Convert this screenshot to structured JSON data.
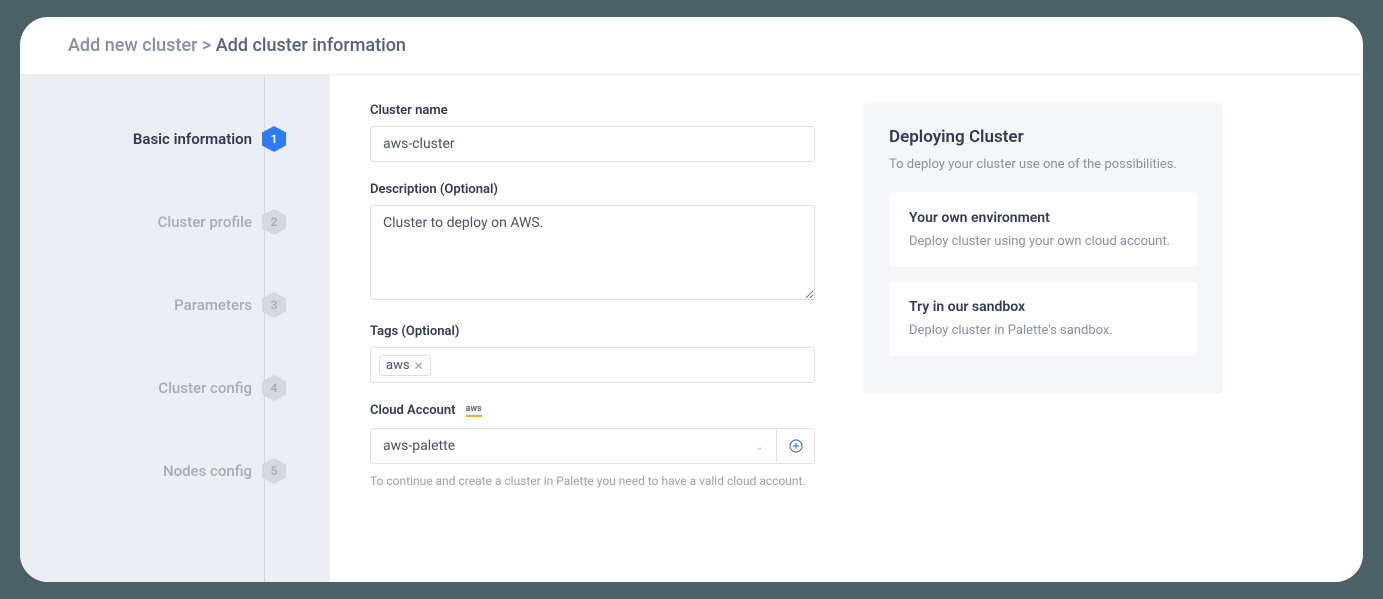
{
  "breadcrumb": {
    "parent": "Add new cluster",
    "separator": ">",
    "current": "Add cluster information"
  },
  "steps": [
    {
      "num": "1",
      "label": "Basic information",
      "active": true
    },
    {
      "num": "2",
      "label": "Cluster profile",
      "active": false
    },
    {
      "num": "3",
      "label": "Parameters",
      "active": false
    },
    {
      "num": "4",
      "label": "Cluster config",
      "active": false
    },
    {
      "num": "5",
      "label": "Nodes config",
      "active": false
    }
  ],
  "form": {
    "cluster_name": {
      "label": "Cluster name",
      "value": "aws-cluster"
    },
    "description": {
      "label": "Description (Optional)",
      "value": "Cluster to deploy on AWS."
    },
    "tags": {
      "label": "Tags (Optional)",
      "items": [
        "aws"
      ]
    },
    "cloud_account": {
      "label": "Cloud Account",
      "provider_badge": "aws",
      "selected": "aws-palette",
      "helper": "To continue and create a cluster in Palette you need to have a valid cloud account."
    }
  },
  "info": {
    "title": "Deploying Cluster",
    "subtitle": "To deploy your cluster use one of the possibilities.",
    "cards": [
      {
        "title": "Your own environment",
        "desc": "Deploy cluster using your own cloud account."
      },
      {
        "title": "Try in our sandbox",
        "desc": "Deploy cluster in Palette's sandbox."
      }
    ]
  }
}
